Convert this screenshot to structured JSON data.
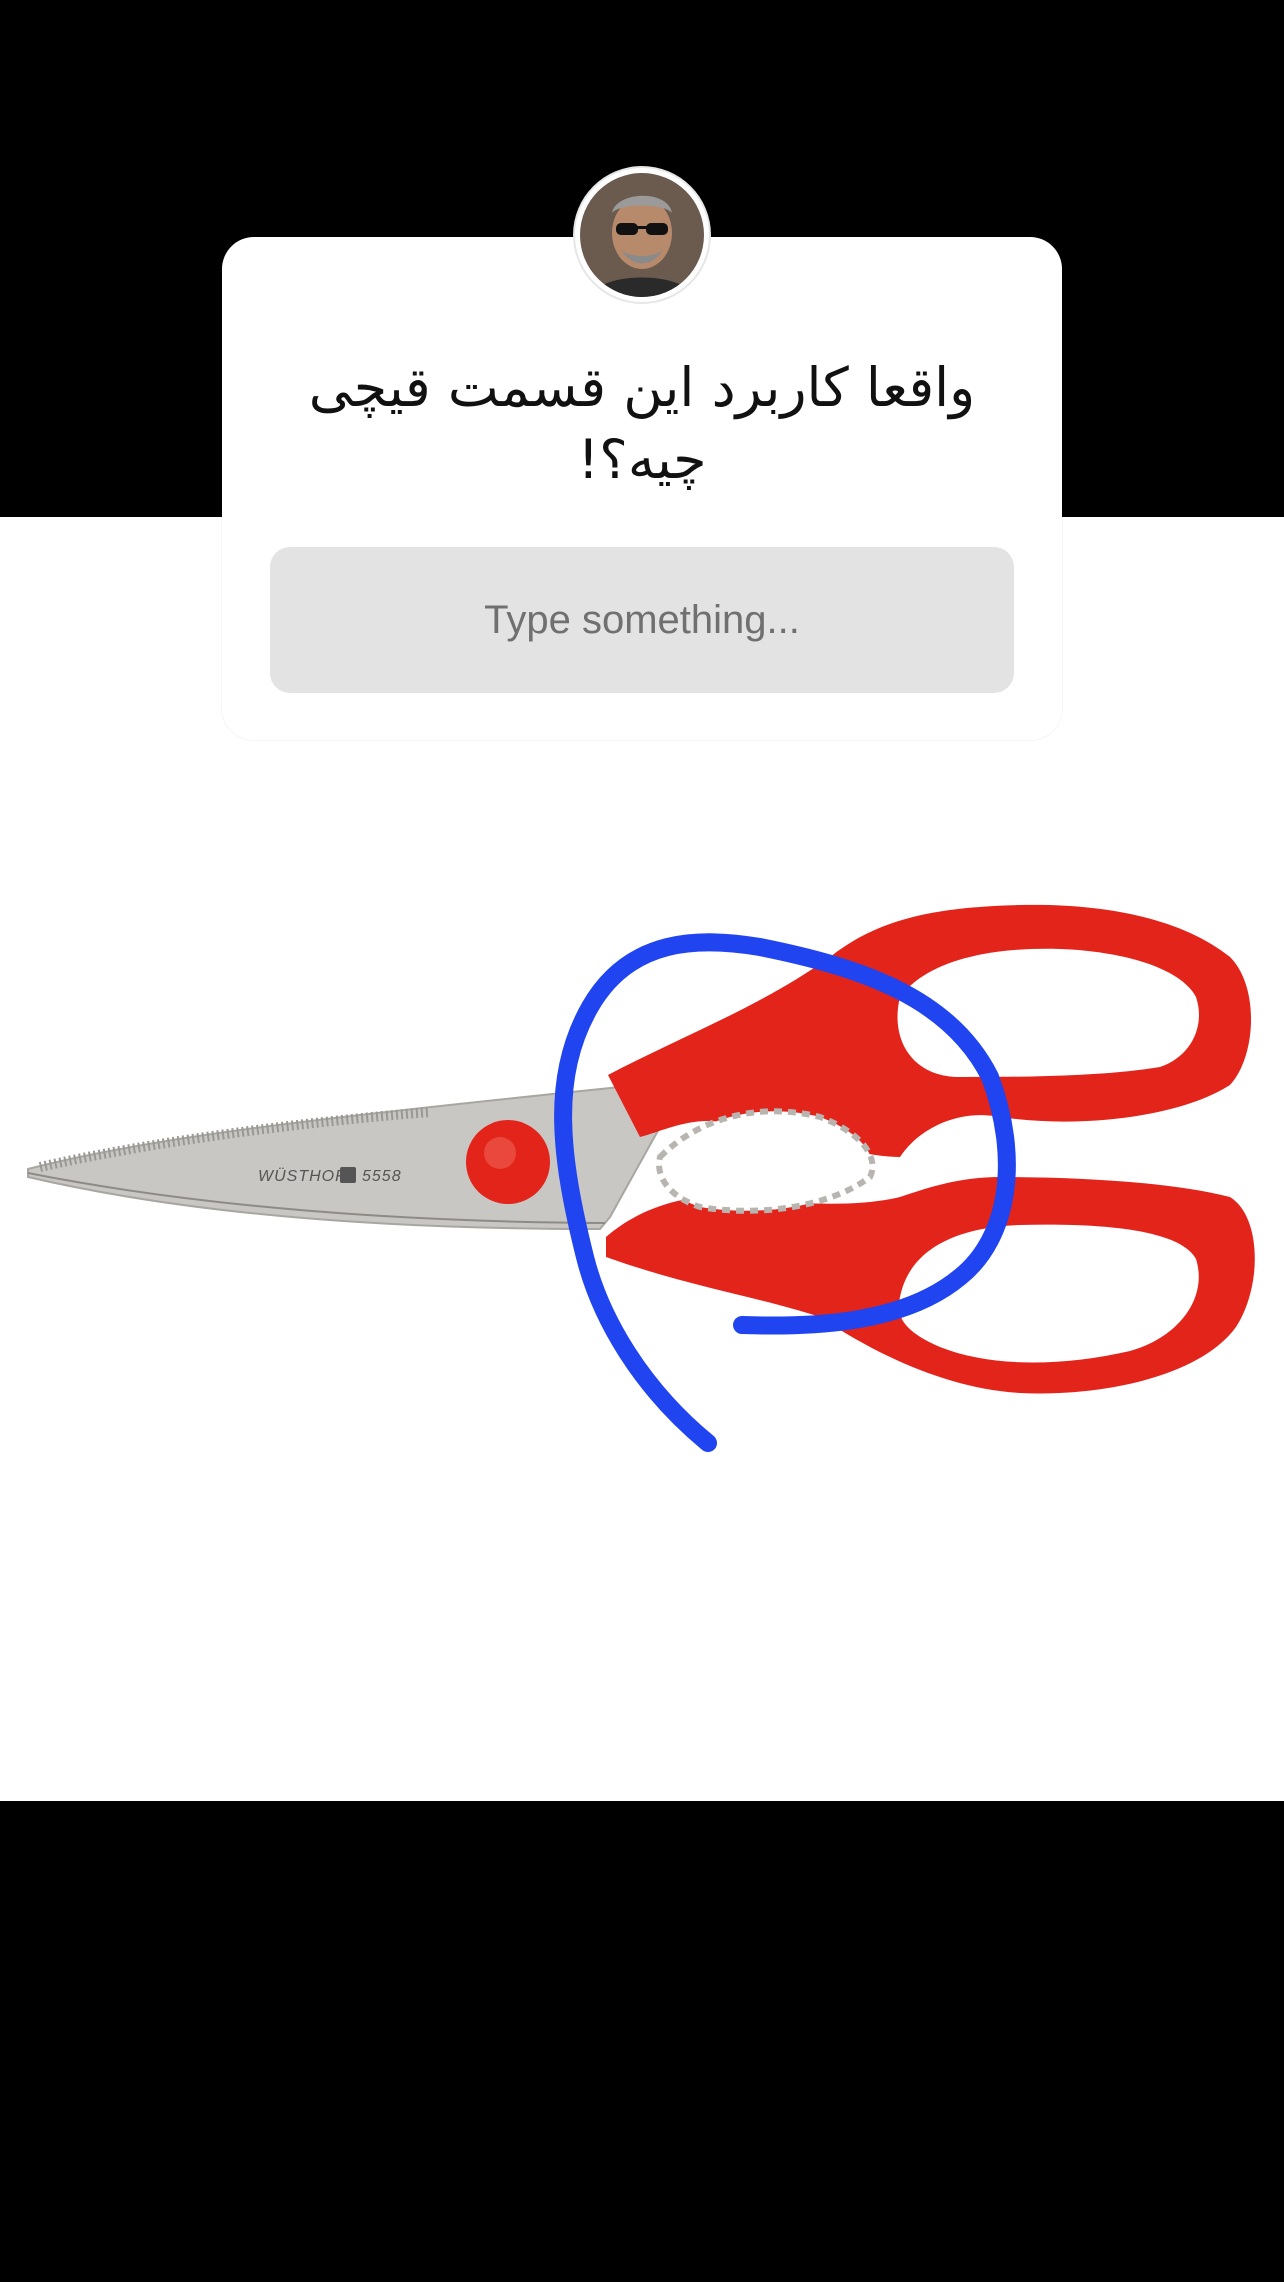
{
  "story": {
    "question": "واقعا کاربرد این قسمت قیچی چیه؟!",
    "reply_placeholder": "Type something...",
    "photo": {
      "brand": "WÜSTHOF",
      "model": "5558"
    }
  },
  "colors": {
    "background": "#000000",
    "card": "#ffffff",
    "input": "#e3e3e3",
    "scissors_handle": "#e3241b",
    "annotation": "#1f44f0"
  },
  "icons": {
    "avatar": "profile-photo",
    "logo": "wusthof-logo-icon"
  }
}
